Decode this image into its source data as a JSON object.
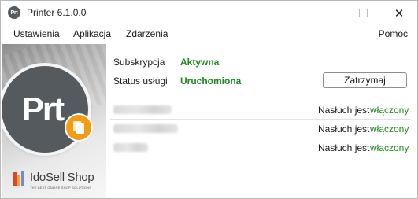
{
  "window": {
    "title": "Printer 6.1.0.0",
    "icon_text": "Prt",
    "controls": {
      "minimize_icon": "minimize-icon",
      "maximize_icon": "maximize-icon",
      "close_icon": "close-icon",
      "close_glyph": "✕"
    }
  },
  "menu": {
    "items": [
      "Ustawienia",
      "Aplikacja",
      "Zdarzenia"
    ],
    "help": "Pomoc"
  },
  "brand": {
    "logo_letters": "Prt",
    "badge_icon": "documents-icon",
    "shop_name": "IdoSell Shop",
    "shop_tagline": "THE BEST ONLINE SHOP SOLUTIONS"
  },
  "status": {
    "subscription_label": "Subskrypcja",
    "subscription_value": "Aktywna",
    "service_label": "Status usługi",
    "service_value": "Uruchomiona",
    "stop_button": "Zatrzymaj"
  },
  "listeners": [
    {
      "label": "Nasłuch jest",
      "state": "włączony"
    },
    {
      "label": "Nasłuch jest",
      "state": "włączony"
    },
    {
      "label": "Nasłuch jest",
      "state": "włączony"
    }
  ],
  "colors": {
    "accent_green": "#1f8a1f",
    "logo_circle": "#545a5d",
    "badge_orange": "#f39c12"
  }
}
